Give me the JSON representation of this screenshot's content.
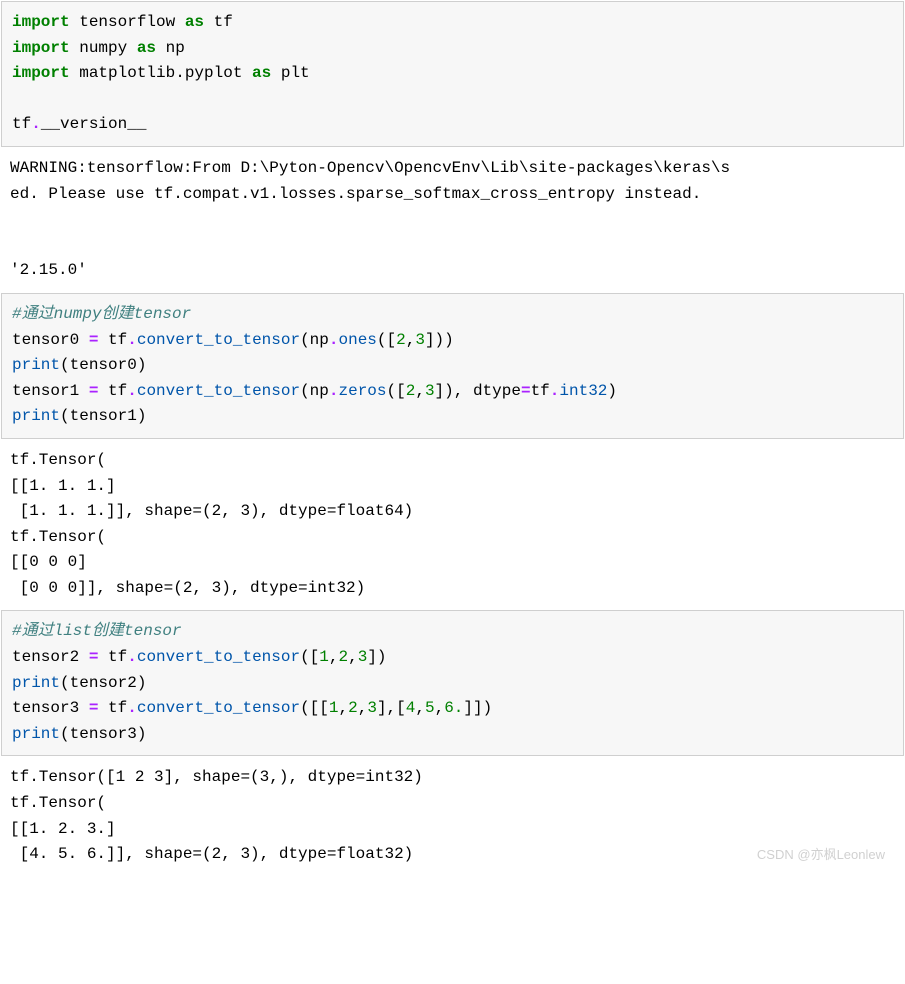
{
  "cell1": {
    "l1_kw": "import",
    "l1_mod": " tensorflow ",
    "l1_as": "as",
    "l1_alias": " tf",
    "l2_kw": "import",
    "l2_mod": " numpy ",
    "l2_as": "as",
    "l2_alias": " np",
    "l3_kw": "import",
    "l3_mod": " matplotlib.pyplot ",
    "l3_as": "as",
    "l3_alias": " plt",
    "l5_a": "tf",
    "l5_b": ".",
    "l5_c": "__version__"
  },
  "out1": {
    "warn1": "WARNING:tensorflow:From D:\\Pyton-Opencv\\OpencvEnv\\Lib\\site-packages\\keras\\s",
    "warn2": "ed. Please use tf.compat.v1.losses.sparse_softmax_cross_entropy instead.",
    "version": "'2.15.0'"
  },
  "cell2": {
    "comment": "#通过numpy创建tensor",
    "l1_a": "tensor0 ",
    "l1_eq": "=",
    "l1_b": " tf",
    "l1_dot": ".",
    "l1_fn": "convert_to_tensor",
    "l1_c": "(np",
    "l1_dot2": ".",
    "l1_fn2": "ones",
    "l1_d": "([",
    "l1_n1": "2",
    "l1_comma": ",",
    "l1_n2": "3",
    "l1_e": "]))",
    "l2": "print",
    "l2b": "(tensor0)",
    "l3_a": "tensor1 ",
    "l3_eq": "=",
    "l3_b": " tf",
    "l3_dot": ".",
    "l3_fn": "convert_to_tensor",
    "l3_c": "(np",
    "l3_dot2": ".",
    "l3_fn2": "zeros",
    "l3_d": "([",
    "l3_n1": "2",
    "l3_comma": ",",
    "l3_n2": "3",
    "l3_e": "]), dtype",
    "l3_eq2": "=",
    "l3_f": "tf",
    "l3_dot3": ".",
    "l3_g": "int32",
    "l3_h": ")",
    "l4": "print",
    "l4b": "(tensor1)"
  },
  "out2": {
    "text": "tf.Tensor(\n[[1. 1. 1.]\n [1. 1. 1.]], shape=(2, 3), dtype=float64)\ntf.Tensor(\n[[0 0 0]\n [0 0 0]], shape=(2, 3), dtype=int32)"
  },
  "cell3": {
    "comment": "#通过list创建tensor",
    "l1_a": "tensor2 ",
    "l1_eq": "=",
    "l1_b": " tf",
    "l1_dot": ".",
    "l1_fn": "convert_to_tensor",
    "l1_c": "([",
    "l1_n1": "1",
    "l1_c1": ",",
    "l1_n2": "2",
    "l1_c2": ",",
    "l1_n3": "3",
    "l1_d": "])",
    "l2": "print",
    "l2b": "(tensor2)",
    "l3_a": "tensor3 ",
    "l3_eq": "=",
    "l3_b": " tf",
    "l3_dot": ".",
    "l3_fn": "convert_to_tensor",
    "l3_c": "([[",
    "l3_n1": "1",
    "l3_c1": ",",
    "l3_n2": "2",
    "l3_c2": ",",
    "l3_n3": "3",
    "l3_d": "],[",
    "l3_n4": "4",
    "l3_c3": ",",
    "l3_n5": "5",
    "l3_c4": ",",
    "l3_n6": "6.",
    "l3_e": "]])",
    "l4": "print",
    "l4b": "(tensor3)"
  },
  "out3": {
    "text": "tf.Tensor([1 2 3], shape=(3,), dtype=int32)\ntf.Tensor(\n[[1. 2. 3.]\n [4. 5. 6.]], shape=(2, 3), dtype=float32)"
  },
  "watermark": "CSDN @亦枫Leonlew"
}
